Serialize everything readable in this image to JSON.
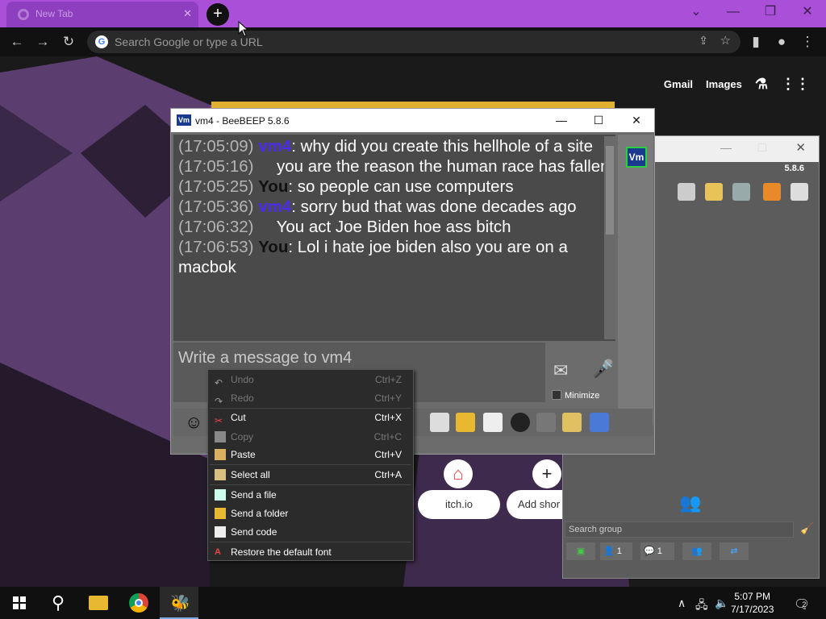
{
  "browser": {
    "tab_title": "New Tab",
    "address_placeholder": "Search Google or type a URL",
    "top_links": [
      "Gmail",
      "Images"
    ]
  },
  "newtab_page": {
    "shortcuts": [
      {
        "label": "itch.io"
      },
      {
        "label": "Add shor"
      }
    ]
  },
  "beebeep": {
    "window_title": "vm4 - BeeBEEP 5.8.6",
    "avatar_text": "Vm",
    "messages": [
      {
        "time": "(17:05:09)",
        "nick": "vm4",
        "sep": ": ",
        "text": "why did you create this hellhole of a site"
      },
      {
        "time": "(17:05:16)",
        "nick": "",
        "sep": "    ",
        "text": "you are the reason the human race has fallen"
      },
      {
        "time": "(17:05:25)",
        "nick": "You",
        "sep": ": ",
        "text": "so people can use computers"
      },
      {
        "time": "(17:05:36)",
        "nick": "vm4",
        "sep": ": ",
        "text": "sorry bud that was done decades ago"
      },
      {
        "time": "(17:06:32)",
        "nick": "",
        "sep": "    ",
        "text": "You act Joe Biden hoe ass bitch"
      },
      {
        "time": "(17:06:53)",
        "nick": "You",
        "sep": ": ",
        "text": "Lol i hate joe biden also you are on a macbok"
      }
    ],
    "input_placeholder": "Write a message to vm4",
    "minimize_label": "Minimize"
  },
  "beebeep_main": {
    "version": "5.8.6",
    "search_placeholder": "Search group",
    "status_counts": [
      "1",
      "1"
    ]
  },
  "context_menu": {
    "items": [
      {
        "label": "Undo",
        "shortcut": "Ctrl+Z",
        "disabled": true
      },
      {
        "label": "Redo",
        "shortcut": "Ctrl+Y",
        "disabled": true
      },
      {
        "label": "Cut",
        "shortcut": "Ctrl+X",
        "disabled": false
      },
      {
        "label": "Copy",
        "shortcut": "Ctrl+C",
        "disabled": true
      },
      {
        "label": "Paste",
        "shortcut": "Ctrl+V",
        "disabled": false
      },
      {
        "label": "Select all",
        "shortcut": "Ctrl+A",
        "disabled": false
      },
      {
        "label": "Send a file",
        "shortcut": "",
        "disabled": false
      },
      {
        "label": "Send a folder",
        "shortcut": "",
        "disabled": false
      },
      {
        "label": "Send code",
        "shortcut": "",
        "disabled": false
      },
      {
        "label": "Restore the default font",
        "shortcut": "",
        "disabled": false
      }
    ]
  },
  "taskbar": {
    "time": "5:07 PM",
    "date": "7/17/2023",
    "notification_count": "2"
  },
  "colors": {
    "tab_strip": "#a94fd8",
    "nick_vm4": "#4a2cf0",
    "chat_bg": "#4a4a4a"
  }
}
